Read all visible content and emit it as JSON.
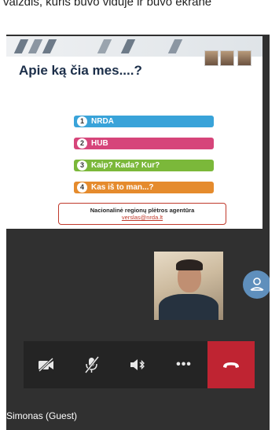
{
  "top_caption": "vaizdis, kuris buvo viduje ir buvo ekrane",
  "slide": {
    "title": "Apie ką čia mes....?",
    "items": [
      {
        "num": "1",
        "label": "NRDA",
        "color": "#39a3d9"
      },
      {
        "num": "2",
        "label": "HUB",
        "color": "#d6457a"
      },
      {
        "num": "3",
        "label": "Kaip? Kada? Kur?",
        "color": "#7bb83a"
      },
      {
        "num": "4",
        "label": "Kas iš to man...?",
        "color": "#e58b2d"
      }
    ],
    "contact_org": "Nacionalinė regionų plėtros agentūra",
    "contact_email": "verslas@nrda.lt"
  },
  "toolbar": {
    "camera": "camera-off-icon",
    "mic": "mic-off-icon",
    "speaker": "speaker-bluetooth-icon",
    "more": "•••",
    "hangup": "hang-up-icon"
  },
  "participant_name": "Simonas (Guest)",
  "colors": {
    "hangup": "#bf2432",
    "avatar": "#5f8fbc",
    "call_bg": "#303030",
    "toolbar": "#242424"
  }
}
